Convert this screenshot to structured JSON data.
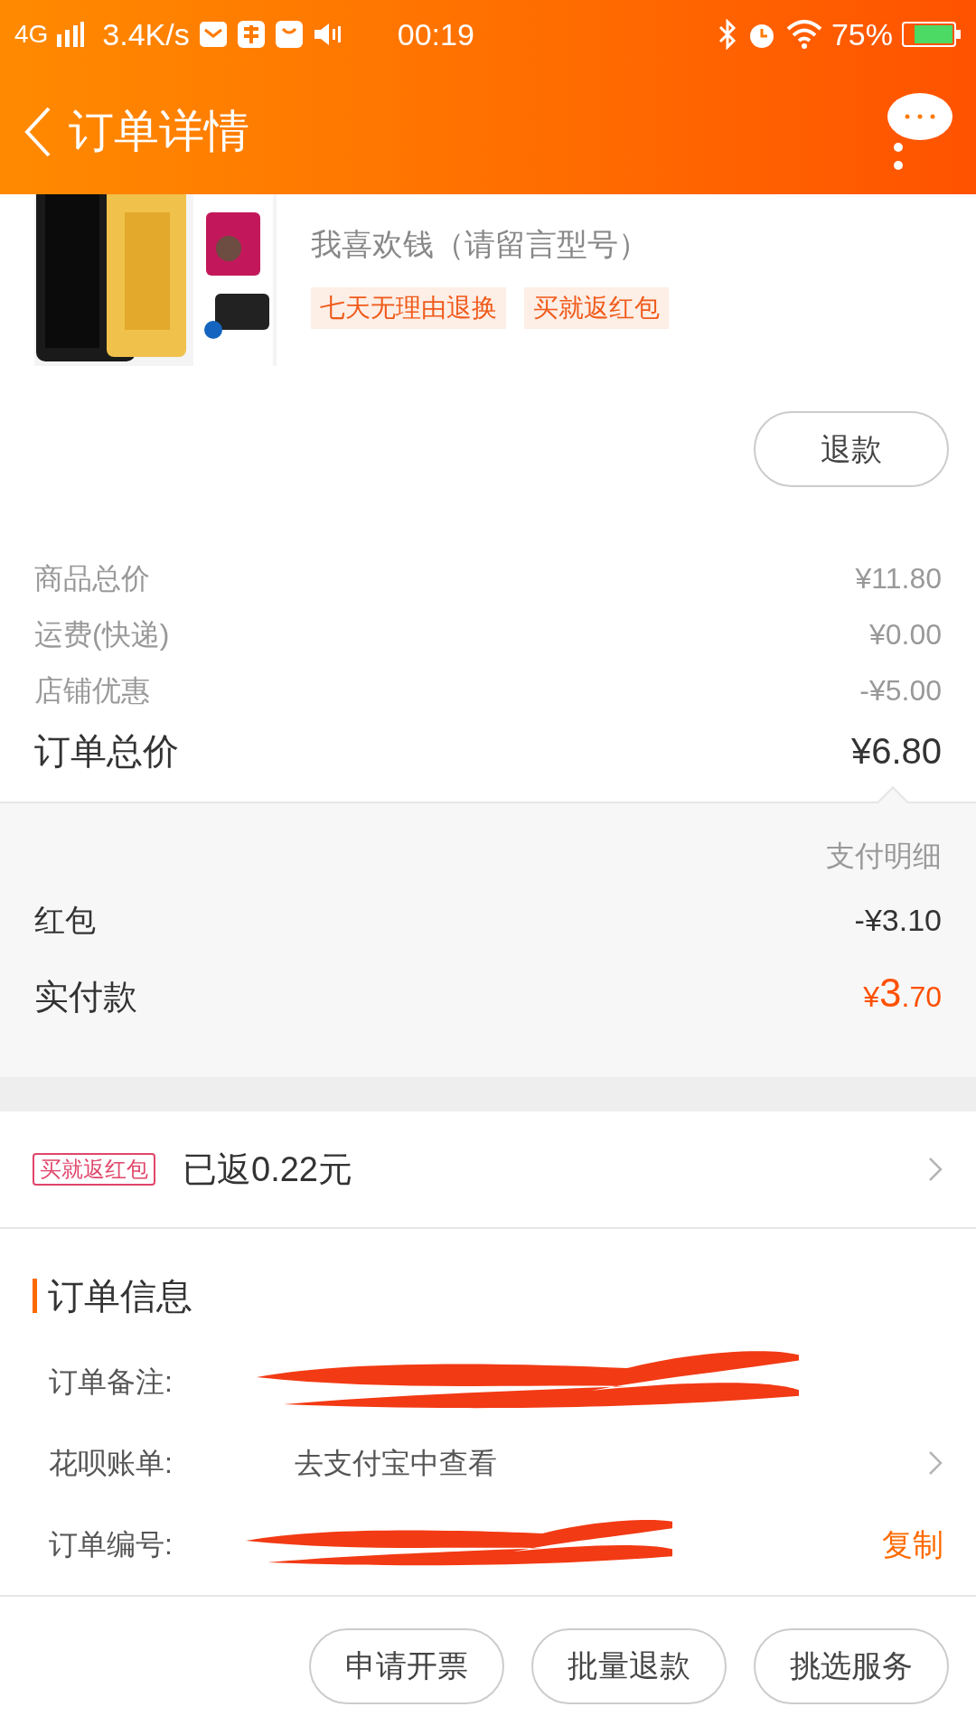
{
  "status_bar": {
    "network": "4G",
    "speed": "3.4K/s",
    "time": "00:19",
    "battery": "75%"
  },
  "header": {
    "title": "订单详情"
  },
  "product": {
    "image": {
      "kind": "picture"
    },
    "spec": "我喜欢钱（请留言型号）",
    "tags": [
      "七天无理由退换",
      "买就返红包"
    ],
    "refund_button": "退款"
  },
  "prices": [
    {
      "label": "商品总价",
      "value": "¥11.80"
    },
    {
      "label": "运费(快递)",
      "value": "¥0.00"
    },
    {
      "label": "店铺优惠",
      "value": "-¥5.00"
    }
  ],
  "total": {
    "label": "订单总价",
    "value": "¥6.80"
  },
  "payment": {
    "title": "支付明细",
    "rows": [
      {
        "label": "红包",
        "value": "-¥3.10"
      }
    ],
    "paid_label": "实付款",
    "paid_value": [
      "¥",
      "3",
      ".70"
    ]
  },
  "rebate": {
    "badge": "买就返红包",
    "text": "已返0.22元"
  },
  "order_info": {
    "title": "订单信息",
    "rows": [
      {
        "label": "订单备注:",
        "kind": "redacted"
      },
      {
        "label": "花呗账单:",
        "kind": "link",
        "value": "去支付宝中查看"
      },
      {
        "label": "订单编号:",
        "kind": "redacted",
        "action": "复制"
      }
    ]
  },
  "bottom_actions": [
    "申请开票",
    "批量退款",
    "挑选服务"
  ]
}
